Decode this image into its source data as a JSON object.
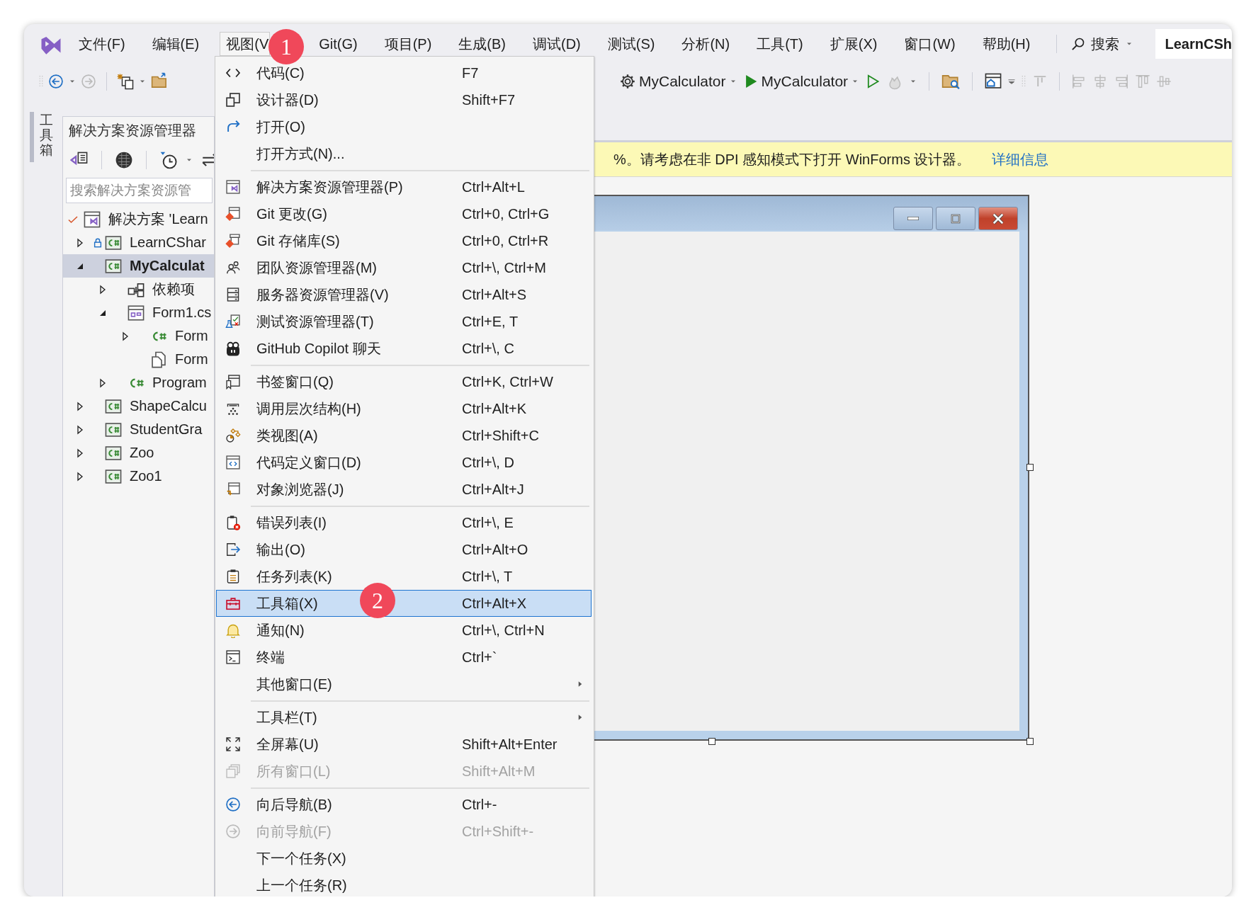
{
  "menubar": {
    "items": [
      {
        "label": "文件(F)",
        "selected": false
      },
      {
        "label": "编辑(E)",
        "selected": false
      },
      {
        "label": "视图(V",
        "selected": true
      },
      {
        "label": "Git(G)",
        "selected": false
      },
      {
        "label": "项目(P)",
        "selected": false
      },
      {
        "label": "生成(B)",
        "selected": false
      },
      {
        "label": "调试(D)",
        "selected": false
      },
      {
        "label": "测试(S)",
        "selected": false
      },
      {
        "label": "分析(N)",
        "selected": false
      },
      {
        "label": "工具(T)",
        "selected": false
      },
      {
        "label": "扩展(X)",
        "selected": false
      },
      {
        "label": "窗口(W)",
        "selected": false
      },
      {
        "label": "帮助(H)",
        "selected": false
      }
    ],
    "search": "搜索",
    "solution_name": "LearnCSh"
  },
  "toolbar": {
    "startup_project": "MyCalculator",
    "run_target": "MyCalculator"
  },
  "toolbox_tab": "工具箱",
  "solution_explorer": {
    "title": "解决方案资源管理器",
    "search": {
      "placeholder": "搜索解决方案资源管"
    },
    "tree": [
      {
        "label": "解决方案 'Learn",
        "kind": "solution",
        "selected": false,
        "children": [
          {
            "label": "LearnCShar",
            "kind": "project",
            "locked": true,
            "expanded": false,
            "selected": false
          },
          {
            "label": "MyCalculat",
            "kind": "project",
            "locked": false,
            "expanded": true,
            "selected": true,
            "children": [
              {
                "label": "依赖项",
                "kind": "dependencies",
                "expanded": false,
                "selected": false
              },
              {
                "label": "Form1.cs",
                "kind": "form",
                "expanded": true,
                "selected": false,
                "children": [
                  {
                    "label": "Form",
                    "kind": "class",
                    "expanded": false,
                    "selected": false
                  },
                  {
                    "label": "Form",
                    "kind": "resource",
                    "selected": false
                  }
                ]
              },
              {
                "label": "Program",
                "kind": "class",
                "expanded": false,
                "selected": false
              }
            ]
          },
          {
            "label": "ShapeCalcu",
            "kind": "project",
            "locked": false,
            "expanded": false,
            "selected": false
          },
          {
            "label": "StudentGra",
            "kind": "project",
            "locked": false,
            "expanded": false,
            "selected": false
          },
          {
            "label": "Zoo",
            "kind": "project",
            "locked": false,
            "expanded": false,
            "selected": false
          },
          {
            "label": "Zoo1",
            "kind": "project",
            "locked": false,
            "expanded": false,
            "selected": false
          }
        ]
      }
    ]
  },
  "info_bar": {
    "message": "%。请考虑在非 DPI 感知模式下打开 WinForms 设计器。",
    "link": "详细信息"
  },
  "view_menu": {
    "entries": [
      {
        "kind": "item",
        "label": "代码(C)",
        "shortcut": "F7",
        "disabled": false,
        "selected": false
      },
      {
        "kind": "item",
        "label": "设计器(D)",
        "shortcut": "Shift+F7",
        "disabled": false,
        "selected": false
      },
      {
        "kind": "item",
        "label": "打开(O)",
        "disabled": false,
        "selected": false
      },
      {
        "kind": "item",
        "label": "打开方式(N)...",
        "disabled": false,
        "selected": false
      },
      {
        "kind": "separator"
      },
      {
        "kind": "item",
        "label": "解决方案资源管理器(P)",
        "shortcut": "Ctrl+Alt+L",
        "disabled": false,
        "selected": false
      },
      {
        "kind": "item",
        "label": "Git 更改(G)",
        "shortcut": "Ctrl+0, Ctrl+G",
        "disabled": false,
        "selected": false
      },
      {
        "kind": "item",
        "label": "Git 存储库(S)",
        "shortcut": "Ctrl+0, Ctrl+R",
        "disabled": false,
        "selected": false
      },
      {
        "kind": "item",
        "label": "团队资源管理器(M)",
        "shortcut": "Ctrl+\\, Ctrl+M",
        "disabled": false,
        "selected": false
      },
      {
        "kind": "item",
        "label": "服务器资源管理器(V)",
        "shortcut": "Ctrl+Alt+S",
        "disabled": false,
        "selected": false
      },
      {
        "kind": "item",
        "label": "测试资源管理器(T)",
        "shortcut": "Ctrl+E, T",
        "disabled": false,
        "selected": false
      },
      {
        "kind": "item",
        "label": "GitHub Copilot 聊天",
        "shortcut": "Ctrl+\\, C",
        "disabled": false,
        "selected": false
      },
      {
        "kind": "separator"
      },
      {
        "kind": "item",
        "label": "书签窗口(Q)",
        "shortcut": "Ctrl+K, Ctrl+W",
        "disabled": false,
        "selected": false
      },
      {
        "kind": "item",
        "label": "调用层次结构(H)",
        "shortcut": "Ctrl+Alt+K",
        "disabled": false,
        "selected": false
      },
      {
        "kind": "item",
        "label": "类视图(A)",
        "shortcut": "Ctrl+Shift+C",
        "disabled": false,
        "selected": false
      },
      {
        "kind": "item",
        "label": "代码定义窗口(D)",
        "shortcut": "Ctrl+\\, D",
        "disabled": false,
        "selected": false
      },
      {
        "kind": "item",
        "label": "对象浏览器(J)",
        "shortcut": "Ctrl+Alt+J",
        "disabled": false,
        "selected": false
      },
      {
        "kind": "separator"
      },
      {
        "kind": "item",
        "label": "错误列表(I)",
        "shortcut": "Ctrl+\\, E",
        "disabled": false,
        "selected": false
      },
      {
        "kind": "item",
        "label": "输出(O)",
        "shortcut": "Ctrl+Alt+O",
        "disabled": false,
        "selected": false
      },
      {
        "kind": "item",
        "label": "任务列表(K)",
        "shortcut": "Ctrl+\\, T",
        "disabled": false,
        "selected": false
      },
      {
        "kind": "item",
        "label": "工具箱(X)",
        "shortcut": "Ctrl+Alt+X",
        "disabled": false,
        "selected": true
      },
      {
        "kind": "item",
        "label": "通知(N)",
        "shortcut": "Ctrl+\\, Ctrl+N",
        "disabled": false,
        "selected": false
      },
      {
        "kind": "item",
        "label": "终端",
        "shortcut": "Ctrl+`",
        "disabled": false,
        "selected": false
      },
      {
        "kind": "submenu",
        "label": "其他窗口(E)",
        "disabled": false,
        "selected": false
      },
      {
        "kind": "separator"
      },
      {
        "kind": "submenu",
        "label": "工具栏(T)",
        "disabled": false,
        "selected": false
      },
      {
        "kind": "item",
        "label": "全屏幕(U)",
        "shortcut": "Shift+Alt+Enter",
        "disabled": false,
        "selected": false
      },
      {
        "kind": "item",
        "label": "所有窗口(L)",
        "shortcut": "Shift+Alt+M",
        "disabled": true,
        "selected": false
      },
      {
        "kind": "separator"
      },
      {
        "kind": "item",
        "label": "向后导航(B)",
        "shortcut": "Ctrl+-",
        "disabled": false,
        "selected": false
      },
      {
        "kind": "item",
        "label": "向前导航(F)",
        "shortcut": "Ctrl+Shift+-",
        "disabled": true,
        "selected": false
      },
      {
        "kind": "item",
        "label": "下一个任务(X)",
        "disabled": false,
        "selected": false
      },
      {
        "kind": "item",
        "label": "上一个任务(R)",
        "disabled": false,
        "selected": false
      }
    ]
  },
  "annotations": [
    {
      "number": "1"
    },
    {
      "number": "2"
    }
  ]
}
